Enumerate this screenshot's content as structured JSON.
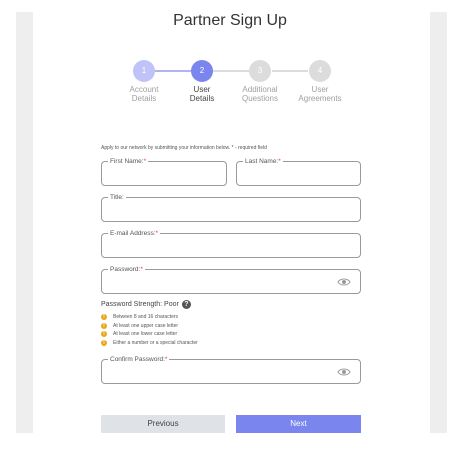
{
  "page": {
    "title": "Partner Sign Up"
  },
  "stepper": {
    "steps": [
      {
        "number": "1",
        "line1": "Account",
        "line2": "Details",
        "state": "done"
      },
      {
        "number": "2",
        "line1": "User",
        "line2": "Details",
        "state": "active"
      },
      {
        "number": "3",
        "line1": "Additional",
        "line2": "Questions",
        "state": "todo"
      },
      {
        "number": "4",
        "line1": "User",
        "line2": "Agreements",
        "state": "todo"
      }
    ]
  },
  "form": {
    "intro": "Apply to our network by submitting your information below. * - required field",
    "required_mark": "*",
    "first_name": {
      "label": "First Name:",
      "value": ""
    },
    "last_name": {
      "label": "Last Name:",
      "value": ""
    },
    "title": {
      "label": "Title:",
      "value": ""
    },
    "email": {
      "label": "E-mail Address:",
      "value": ""
    },
    "password": {
      "label": "Password:",
      "value": ""
    },
    "password_strength": {
      "label": "Password Strength: Poor",
      "help": "?"
    },
    "rules": [
      "Between 8 and 16 characters",
      "At least one upper case letter",
      "At least one lower case letter",
      "Either a number or a special character"
    ],
    "warn_glyph": "!",
    "confirm_password": {
      "label": "Confirm Password:",
      "value": ""
    }
  },
  "buttons": {
    "previous": "Previous",
    "next": "Next"
  },
  "colors": {
    "accent": "#7b85ee",
    "accent_light": "#bfc3f7",
    "inactive": "#dcdcdc",
    "warning": "#e8a718",
    "required": "#e0453a"
  },
  "icons": {
    "eye": "eye-icon",
    "help": "help-icon",
    "warning": "warning-icon"
  }
}
